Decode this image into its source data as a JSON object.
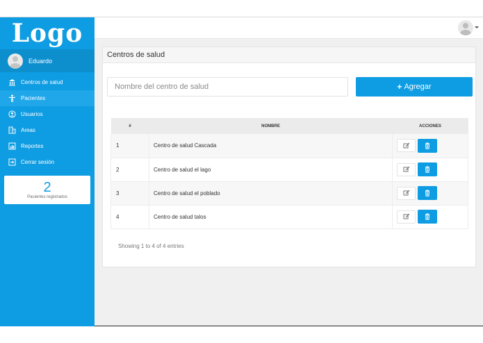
{
  "sidebar": {
    "logo": "Logo",
    "user": "Eduardo",
    "items": [
      {
        "label": "Centros de salud",
        "icon": "bank-icon"
      },
      {
        "label": "Pacientes",
        "icon": "person-icon"
      },
      {
        "label": "Usuarios",
        "icon": "user-circle-icon"
      },
      {
        "label": "Areas",
        "icon": "building-icon"
      },
      {
        "label": "Reportes",
        "icon": "chart-icon"
      },
      {
        "label": "Cerrar sesión",
        "icon": "logout-icon"
      }
    ],
    "stat": {
      "count": "2",
      "label": "Pacientes registrados"
    }
  },
  "main": {
    "title": "Centros de salud",
    "search_placeholder": "Nombre del centro de salud",
    "add_label": "Agregar",
    "table": {
      "headers": [
        "#",
        "NOMBRE",
        "ACCIONES"
      ],
      "rows": [
        {
          "num": "1",
          "name": "Centro de salud Cascada"
        },
        {
          "num": "2",
          "name": "Centro de salud el lago"
        },
        {
          "num": "3",
          "name": "Centro de salud el poblado"
        },
        {
          "num": "4",
          "name": "Centro de salud talos"
        }
      ]
    },
    "footer": "Showing 1 to 4 of 4 entries"
  },
  "colors": {
    "primary": "#0e9ce2",
    "sidebar_active": "#1fa7ea",
    "user_bar": "#0d8fce"
  }
}
